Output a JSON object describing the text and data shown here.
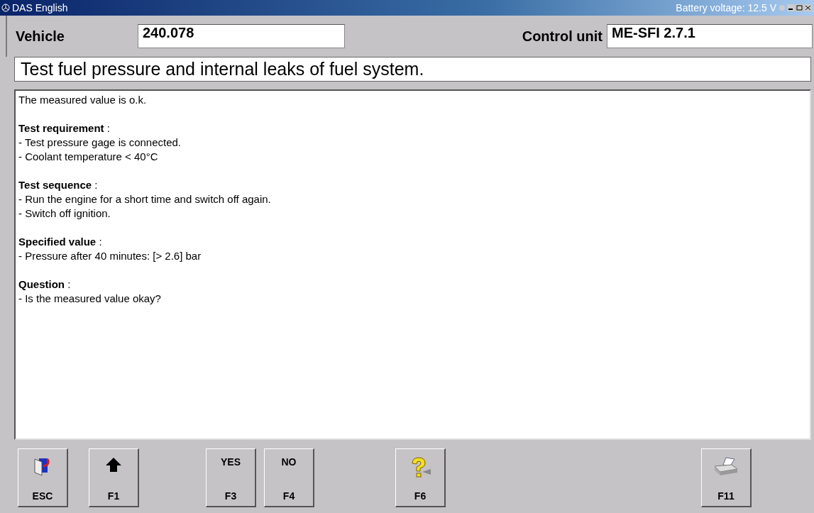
{
  "window": {
    "title": "DAS English",
    "battery": "Battery voltage: 12.5 V"
  },
  "header": {
    "vehicle_label": "Vehicle",
    "vehicle_value": "240.078",
    "control_unit_label": "Control unit",
    "control_unit_value": "ME-SFI 2.7.1"
  },
  "test_title": "Test fuel pressure and internal leaks of fuel system.",
  "content": {
    "intro": "The measured value is o.k.",
    "sections": [
      {
        "heading": "**Test requirement** :",
        "lines": [
          "- Test pressure gage is connected.",
          "- Coolant temperature < 40°C"
        ]
      },
      {
        "heading": "**Test sequence** :",
        "lines": [
          "- Run the engine for a short time and switch off again.",
          "- Switch off ignition."
        ]
      },
      {
        "heading": "**Specified value** :",
        "lines": [
          "- Pressure after 40 minutes: [> 2.6] bar"
        ]
      },
      {
        "heading": "**Question** :",
        "lines": [
          "- Is the measured value okay?"
        ]
      }
    ]
  },
  "buttons": [
    {
      "kind": "exit",
      "key": "ESC"
    },
    {
      "kind": "up",
      "key": "F1"
    },
    {
      "kind": "text",
      "label": "YES",
      "key": "F3"
    },
    {
      "kind": "text",
      "label": "NO",
      "key": "F4"
    },
    {
      "kind": "help",
      "key": "F6"
    },
    {
      "kind": "print",
      "key": "F11"
    }
  ]
}
